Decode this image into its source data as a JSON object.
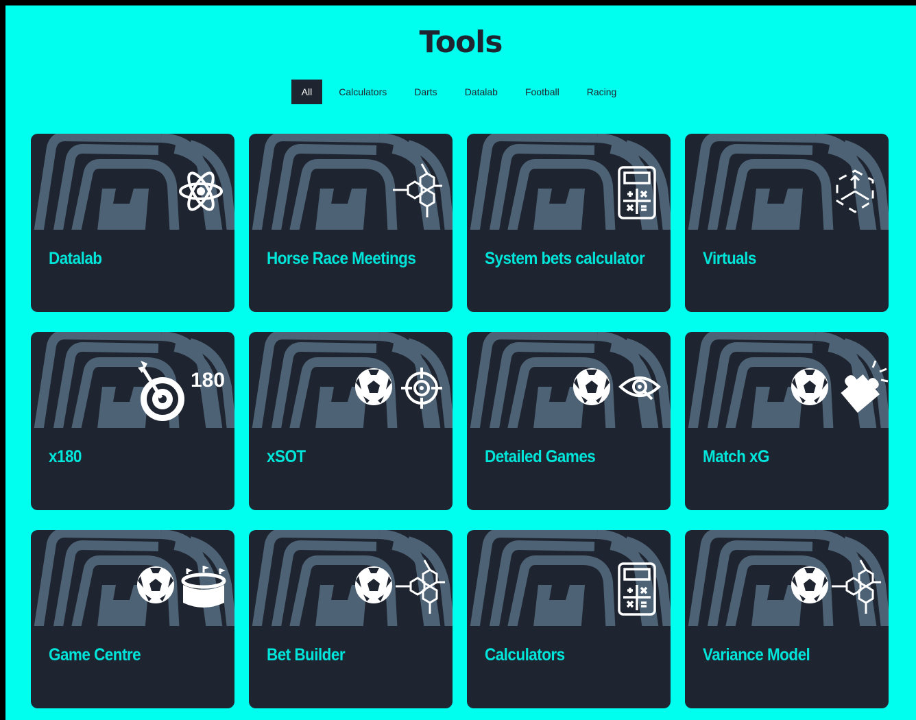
{
  "page": {
    "title": "Tools"
  },
  "filters": [
    {
      "label": "All",
      "active": true
    },
    {
      "label": "Calculators",
      "active": false
    },
    {
      "label": "Darts",
      "active": false
    },
    {
      "label": "Datalab",
      "active": false
    },
    {
      "label": "Football",
      "active": false
    },
    {
      "label": "Racing",
      "active": false
    }
  ],
  "colors": {
    "page_background": "#00ffee",
    "card_background": "#1f2530",
    "card_title": "#00e5da",
    "watermark": "#4d6275",
    "icon": "#ffffff"
  },
  "tools": [
    {
      "title": "Datalab",
      "icons": [
        "atom-icon"
      ]
    },
    {
      "title": "Horse Race Meetings",
      "icons": [
        "molecule-icon"
      ]
    },
    {
      "title": "System bets calculator",
      "icons": [
        "calculator-icon"
      ]
    },
    {
      "title": "Virtuals",
      "icons": [
        "cube-icon"
      ]
    },
    {
      "title": "x180",
      "icons": [
        "dartboard-icon",
        "180-badge"
      ],
      "badge_text": "180"
    },
    {
      "title": "xSOT",
      "icons": [
        "football-icon",
        "crosshair-icon"
      ]
    },
    {
      "title": "Detailed Games",
      "icons": [
        "football-icon",
        "eye-icon"
      ]
    },
    {
      "title": "Match xG",
      "icons": [
        "football-icon",
        "puzzle-icon"
      ]
    },
    {
      "title": "Game Centre",
      "icons": [
        "football-icon",
        "stadium-icon"
      ]
    },
    {
      "title": "Bet Builder",
      "icons": [
        "football-icon",
        "molecule-icon"
      ]
    },
    {
      "title": "Calculators",
      "icons": [
        "calculator-icon"
      ]
    },
    {
      "title": "Variance Model",
      "icons": [
        "football-icon",
        "molecule-icon"
      ]
    }
  ]
}
